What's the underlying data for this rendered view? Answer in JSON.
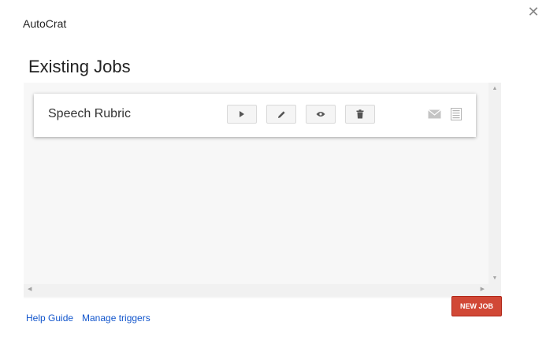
{
  "app": {
    "title": "AutoCrat"
  },
  "main": {
    "heading": "Existing Jobs",
    "jobs": [
      {
        "name": "Speech Rubric"
      }
    ]
  },
  "icons": {
    "close": "close-icon",
    "run": "play-icon",
    "edit": "pencil-icon",
    "preview": "eye-icon",
    "delete": "trash-icon",
    "email": "envelope-icon",
    "doc": "document-icon"
  },
  "footer": {
    "help_label": "Help Guide",
    "triggers_label": "Manage triggers",
    "new_job_label": "NEW JOB"
  },
  "colors": {
    "accent": "#d14836",
    "link": "#1155cc"
  }
}
